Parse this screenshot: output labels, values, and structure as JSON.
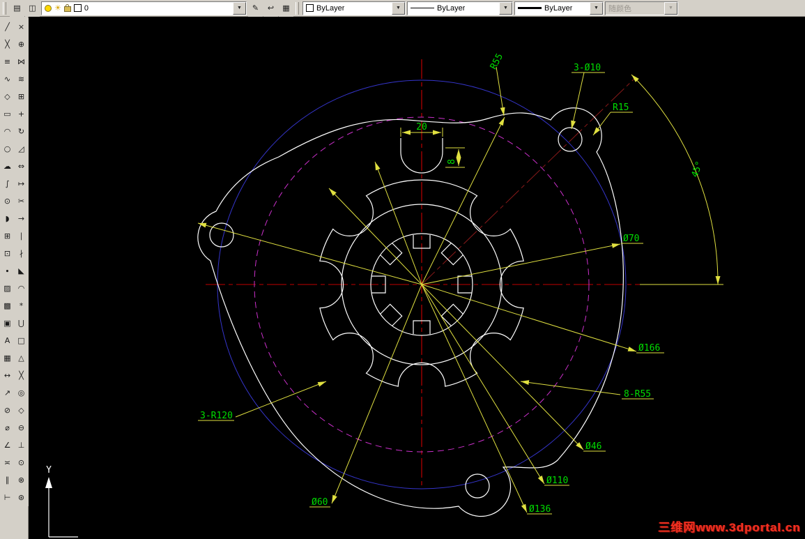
{
  "top_toolbar": {
    "left_buttons": [
      {
        "name": "layer-properties-manager",
        "glyph": "▤"
      },
      {
        "name": "layers-palette",
        "glyph": "◫"
      }
    ],
    "layer_combo": {
      "value": "0"
    },
    "right_buttons": [
      {
        "name": "make-object-layer-current",
        "glyph": "✎"
      },
      {
        "name": "layer-previous",
        "glyph": "↩"
      },
      {
        "name": "layer-states",
        "glyph": "▦"
      }
    ],
    "color_combo": {
      "value": "ByLayer"
    },
    "linetype_combo": {
      "value": "ByLayer"
    },
    "lineweight_combo": {
      "value": "ByLayer"
    },
    "plotstyle_combo": {
      "value": "随颜色"
    }
  },
  "left_toolbar": {
    "columns": [
      [
        {
          "name": "line",
          "glyph": "╱"
        },
        {
          "name": "construction-line",
          "glyph": "╳"
        },
        {
          "name": "multiline",
          "glyph": "≡"
        },
        {
          "name": "polyline",
          "glyph": "∿"
        },
        {
          "name": "polygon",
          "glyph": "◇"
        },
        {
          "name": "rectangle",
          "glyph": "▭"
        },
        {
          "name": "arc",
          "glyph": "◠"
        },
        {
          "name": "circle",
          "glyph": "○"
        },
        {
          "name": "revision-cloud",
          "glyph": "☁"
        },
        {
          "name": "spline",
          "glyph": "∫"
        },
        {
          "name": "ellipse",
          "glyph": "⊙"
        },
        {
          "name": "ellipse-arc",
          "glyph": "◗"
        },
        {
          "name": "insert-block",
          "glyph": "⊞"
        },
        {
          "name": "make-block",
          "glyph": "⊡"
        },
        {
          "name": "point",
          "glyph": "∙"
        },
        {
          "name": "hatch",
          "glyph": "▨"
        },
        {
          "name": "gradient",
          "glyph": "▩"
        },
        {
          "name": "region",
          "glyph": "▣"
        },
        {
          "name": "multiline-text",
          "glyph": "A"
        },
        {
          "name": "table",
          "glyph": "▦"
        },
        {
          "name": "dim-linear",
          "glyph": "↔"
        },
        {
          "name": "dim-aligned",
          "glyph": "↗"
        },
        {
          "name": "dim-radius",
          "glyph": "⊘"
        },
        {
          "name": "dim-diameter",
          "glyph": "⌀"
        },
        {
          "name": "dim-angular",
          "glyph": "∠"
        },
        {
          "name": "quick-dim",
          "glyph": "≍"
        },
        {
          "name": "dim-baseline",
          "glyph": "∥"
        },
        {
          "name": "dim-continue",
          "glyph": "⊢"
        }
      ],
      [
        {
          "name": "erase",
          "glyph": "×"
        },
        {
          "name": "copy",
          "glyph": "⊕"
        },
        {
          "name": "mirror",
          "glyph": "⋈"
        },
        {
          "name": "offset",
          "glyph": "≋"
        },
        {
          "name": "array",
          "glyph": "⊞"
        },
        {
          "name": "move",
          "glyph": "+"
        },
        {
          "name": "rotate",
          "glyph": "↻"
        },
        {
          "name": "scale",
          "glyph": "◿"
        },
        {
          "name": "stretch",
          "glyph": "⇔"
        },
        {
          "name": "lengthen",
          "glyph": "↦"
        },
        {
          "name": "trim",
          "glyph": "✂"
        },
        {
          "name": "extend",
          "glyph": "→"
        },
        {
          "name": "break-at-point",
          "glyph": "∣"
        },
        {
          "name": "break",
          "glyph": "∤"
        },
        {
          "name": "chamfer",
          "glyph": "◣"
        },
        {
          "name": "fillet",
          "glyph": "◠"
        },
        {
          "name": "explode",
          "glyph": "*"
        },
        {
          "name": "join",
          "glyph": "⋃"
        },
        {
          "name": "snap-endpoint",
          "glyph": "□"
        },
        {
          "name": "snap-midpoint",
          "glyph": "△"
        },
        {
          "name": "snap-intersection",
          "glyph": "╳"
        },
        {
          "name": "snap-center",
          "glyph": "◎"
        },
        {
          "name": "snap-quadrant",
          "glyph": "◇"
        },
        {
          "name": "snap-tangent",
          "glyph": "⊖"
        },
        {
          "name": "snap-perpendicular",
          "glyph": "⊥"
        },
        {
          "name": "snap-node",
          "glyph": "⊙"
        },
        {
          "name": "snap-nearest",
          "glyph": "⊗"
        },
        {
          "name": "snap-settings",
          "glyph": "⊛"
        }
      ]
    ]
  },
  "dims": {
    "r55": "R55",
    "holes3_d10": "3-Ø10",
    "r15": "R15",
    "angle": "45°",
    "d70": "Ø70",
    "d166": "Ø166",
    "scallops": "8-R55",
    "d46": "Ø46",
    "d110": "Ø110",
    "d136": "Ø136",
    "d60": "Ø60",
    "arcs3_r120": "3-R120",
    "notch_width": "20",
    "notch_depth": "8"
  },
  "ucs": {
    "y_label": "Y"
  },
  "watermark": {
    "text": "三维网www.3dportal.cn"
  },
  "colors": {
    "dim_text": "#00dd00",
    "dim_line": "#e0e040",
    "centerline_red": "#e00000",
    "centerline_dark_red": "#8a1a1a",
    "circle_blue": "#3535cc",
    "circle_magenta": "#cc30cc",
    "geometry_white": "#ffffff"
  }
}
